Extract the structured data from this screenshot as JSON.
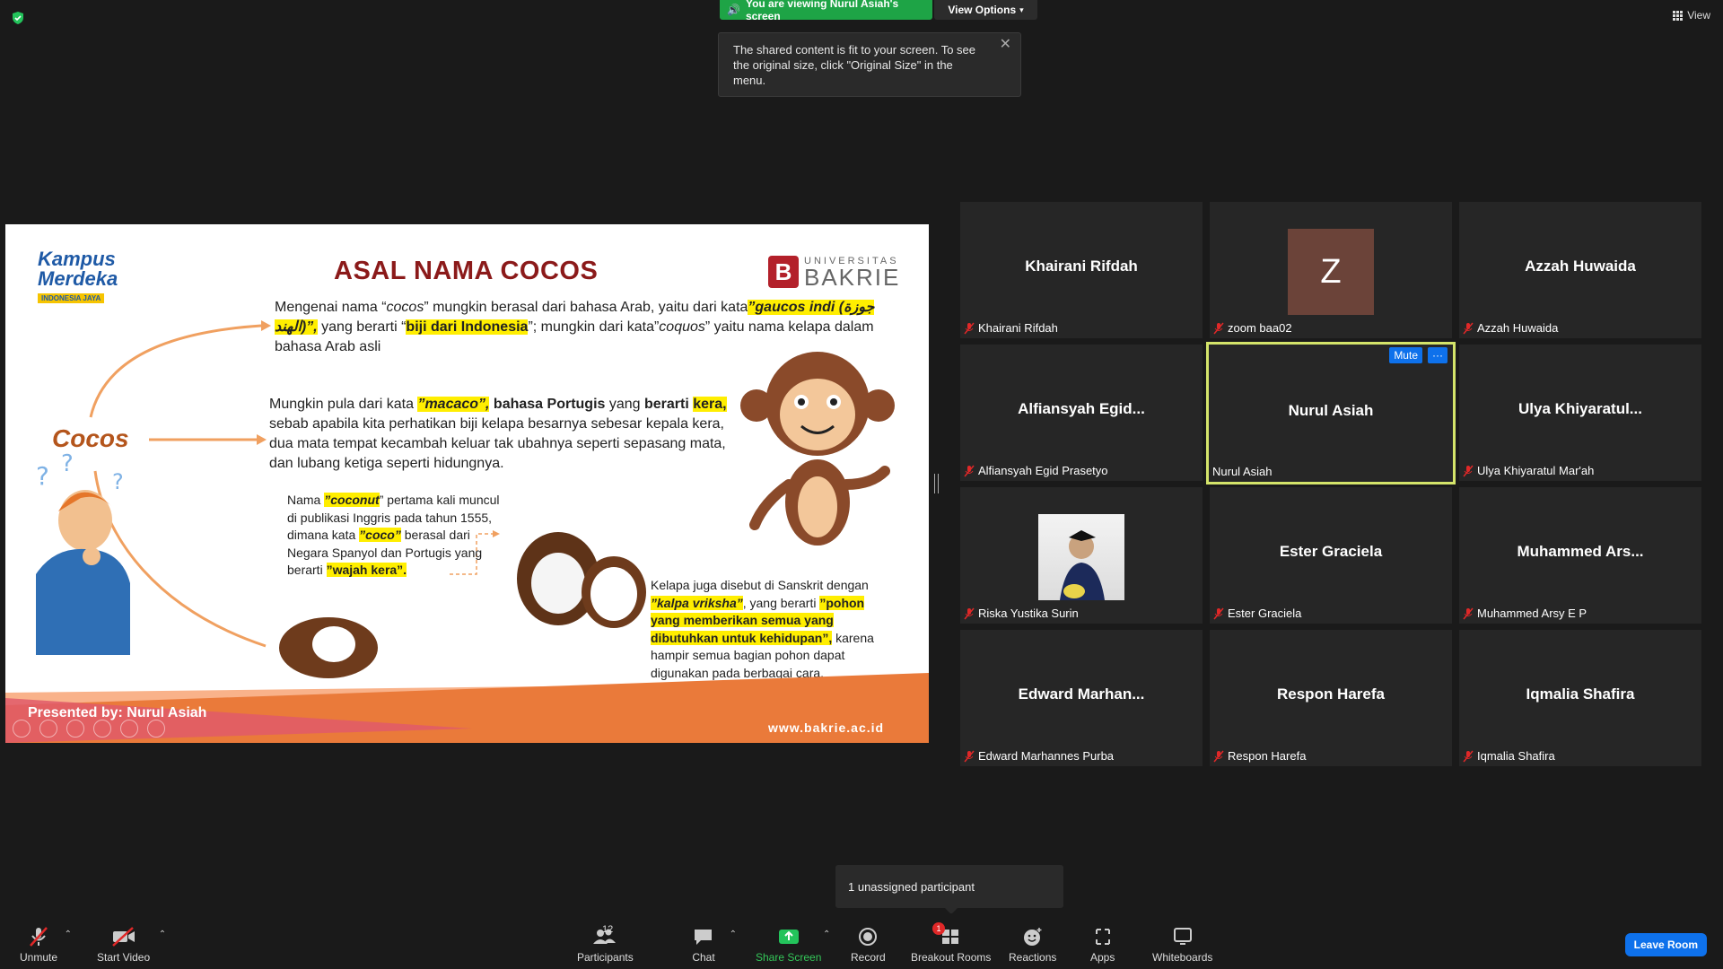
{
  "banner": {
    "viewing_text": "You are viewing Nurul Asiah's screen",
    "view_options": "View Options",
    "view_top_right": "View"
  },
  "tooltip": {
    "text": "The shared content is fit to your screen. To see the original size, click \"Original Size\" in the menu."
  },
  "slide": {
    "title": "ASAL NAMA COCOS",
    "logo_left_1": "Kampus",
    "logo_left_2": "Merdeka",
    "logo_left_3": "INDONESIA JAYA",
    "logo_right_small": "UNIVERSITAS",
    "logo_right_big": "BAKRIE",
    "logo_right_mark": "B",
    "cocos": "Cocos",
    "p1_a": "Mengenai nama “",
    "p1_b": "cocos",
    "p1_c": "” mungkin berasal dari bahasa Arab, yaitu dari kata",
    "p1_d": "”gaucos indi (جوزة الهند)”,",
    "p1_e": " yang berarti “",
    "p1_f": "biji dari Indonesia",
    "p1_g": "”; mungkin dari kata”",
    "p1_h": "coquos",
    "p1_i": "” yaitu nama kelapa dalam bahasa Arab asli",
    "p2_a": "Mungkin pula dari kata ",
    "p2_b": "”macaco”,",
    "p2_c": " bahasa Portugis",
    "p2_d": " yang ",
    "p2_e": "berarti ",
    "p2_f": "kera,",
    "p2_g": " sebab apabila kita perhatikan biji kelapa besarnya sebesar kepala kera, dua mata tempat kecambah keluar tak ubahnya seperti sepasang mata, dan lubang ketiga seperti hidungnya.",
    "p3_a": "Nama ",
    "p3_b": "”coconut",
    "p3_c": "” pertama kali muncul di publikasi Inggris pada tahun 1555, dimana kata ",
    "p3_d": "”coco”",
    "p3_e": " berasal dari Negara Spanyol dan Portugis yang berarti ",
    "p3_f": "”wajah kera”.",
    "p4_a": "Kelapa juga disebut di Sanskrit dengan ",
    "p4_b": "”kalpa vriksha”",
    "p4_c": ", yang berarti ",
    "p4_d": "”pohon yang memberikan semua yang dibutuhkan untuk kehidupan”,",
    "p4_e": " karena hampir semua bagian pohon dapat digunakan pada berbagai cara.",
    "presented_by": "Presented by: Nurul Asiah",
    "website": "www.bakrie.ac.id"
  },
  "gallery": [
    {
      "display": "Khairani Rifdah",
      "label": "Khairani Rifdah"
    },
    {
      "display": "Z",
      "label": "zoom baa02"
    },
    {
      "display": "Azzah Huwaida",
      "label": "Azzah Huwaida"
    },
    {
      "display": "Alfiansyah  Egid...",
      "label": "Alfiansyah Egid Prasetyo"
    },
    {
      "display": "Nurul Asiah",
      "label": "Nurul Asiah"
    },
    {
      "display": "Ulya  Khiyaratul...",
      "label": "Ulya Khiyaratul Mar'ah"
    },
    {
      "display": "",
      "label": "Riska Yustika Surin"
    },
    {
      "display": "Ester Graciela",
      "label": "Ester Graciela"
    },
    {
      "display": "Muhammed  Ars...",
      "label": "Muhammed Arsy E P"
    },
    {
      "display": "Edward  Marhan...",
      "label": "Edward Marhannes Purba"
    },
    {
      "display": "Respon Harefa",
      "label": "Respon Harefa"
    },
    {
      "display": "Iqmalia Shafira",
      "label": "Iqmalia Shafira"
    }
  ],
  "tile_buttons": {
    "mute": "Mute",
    "more": "···"
  },
  "unassigned": "1 unassigned participant",
  "toolbar": {
    "unmute": "Unmute",
    "start_video": "Start Video",
    "participants": "Participants",
    "participants_count": "12",
    "chat": "Chat",
    "share_screen": "Share Screen",
    "record": "Record",
    "breakout_rooms": "Breakout Rooms",
    "breakout_badge": "1",
    "reactions": "Reactions",
    "apps": "Apps",
    "whiteboards": "Whiteboards",
    "leave_room": "Leave Room"
  },
  "colors": {
    "accent": "#0e71eb",
    "share_green": "#1ea446",
    "active_speaker": "#d4e46a",
    "mic_off_red": "#e02828"
  }
}
